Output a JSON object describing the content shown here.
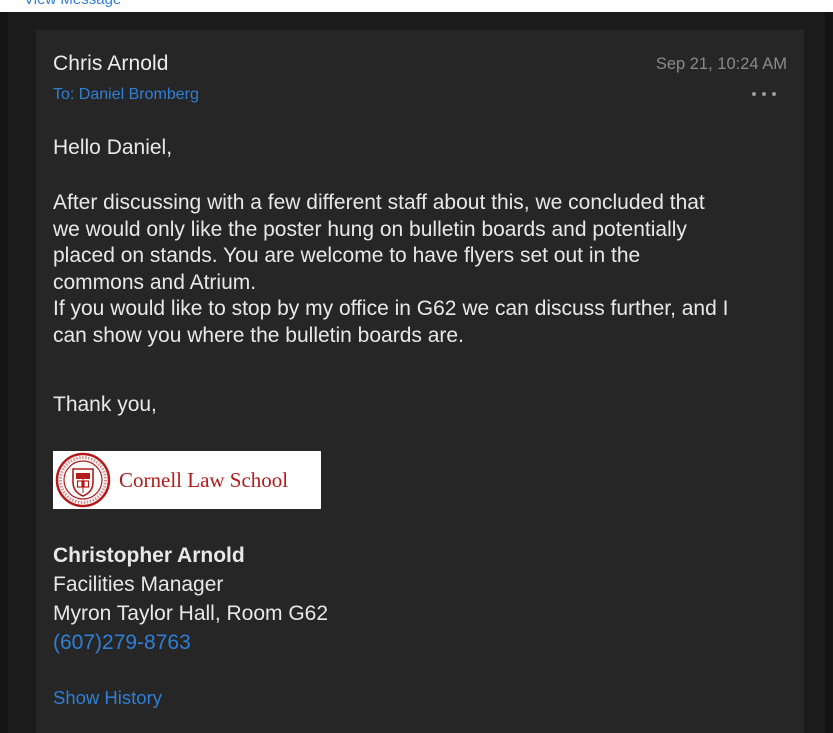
{
  "header": {
    "top_link": "View Message"
  },
  "message": {
    "sender": "Chris Arnold",
    "to": "To: Daniel Bromberg",
    "date": "Sep 21, 10:24 AM",
    "greeting": "Hello Daniel,",
    "paragraph_lines": [
      "After discussing with a few different staff about this, we concluded that",
      "we would only like the poster hung on bulletin boards and potentially",
      "placed on stands.  You are welcome to have flyers set out in the",
      "commons and Atrium.",
      "If you would like to stop by my office in G62 we can discuss further, and I",
      "can show you where the bulletin boards are."
    ],
    "closing": "Thank you,"
  },
  "logo": {
    "text": "Cornell Law School",
    "color": "#b31b1b"
  },
  "signature": {
    "name": "Christopher Arnold",
    "title": "Facilities Manager",
    "office": "Myron Taylor Hall, Room G62",
    "phone": "(607)279-8763"
  },
  "actions": {
    "show_history": "Show History",
    "more_icon": "more-horizontal-icon"
  },
  "colors": {
    "link": "#2f7fd6",
    "background": "#262626",
    "text": "#e8e8e8",
    "muted": "#8a8a8a"
  }
}
